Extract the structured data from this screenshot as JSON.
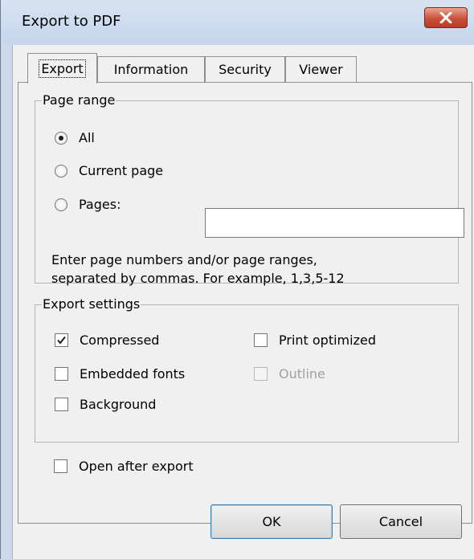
{
  "window": {
    "title": "Export to PDF"
  },
  "tabs": [
    {
      "label": "Export",
      "selected": true
    },
    {
      "label": "Information",
      "selected": false
    },
    {
      "label": "Security",
      "selected": false
    },
    {
      "label": "Viewer",
      "selected": false
    }
  ],
  "page_range": {
    "legend": "Page range",
    "options": [
      {
        "label": "All",
        "selected": true
      },
      {
        "label": "Current page",
        "selected": false
      },
      {
        "label": "Pages:",
        "selected": false
      }
    ],
    "pages_value": "",
    "hint_line1": "Enter page numbers and/or page ranges,",
    "hint_line2": "separated by commas. For example, 1,3,5-12"
  },
  "export_settings": {
    "legend": "Export settings",
    "compressed": {
      "label": "Compressed",
      "checked": true
    },
    "embedded_fonts": {
      "label": "Embedded fonts",
      "checked": false
    },
    "background": {
      "label": "Background",
      "checked": false
    },
    "print_optimized": {
      "label": "Print optimized",
      "checked": false
    },
    "outline": {
      "label": "Outline",
      "checked": false,
      "enabled": false
    }
  },
  "open_after_export": {
    "label": "Open after export",
    "checked": false
  },
  "buttons": {
    "ok": "OK",
    "cancel": "Cancel"
  },
  "icons": {
    "close": "close-icon",
    "check": "checkmark-icon"
  },
  "colors": {
    "close_button": "#c9503a",
    "title_bar": "#cbd9ea",
    "dialog_bg": "#f0f0f0"
  }
}
